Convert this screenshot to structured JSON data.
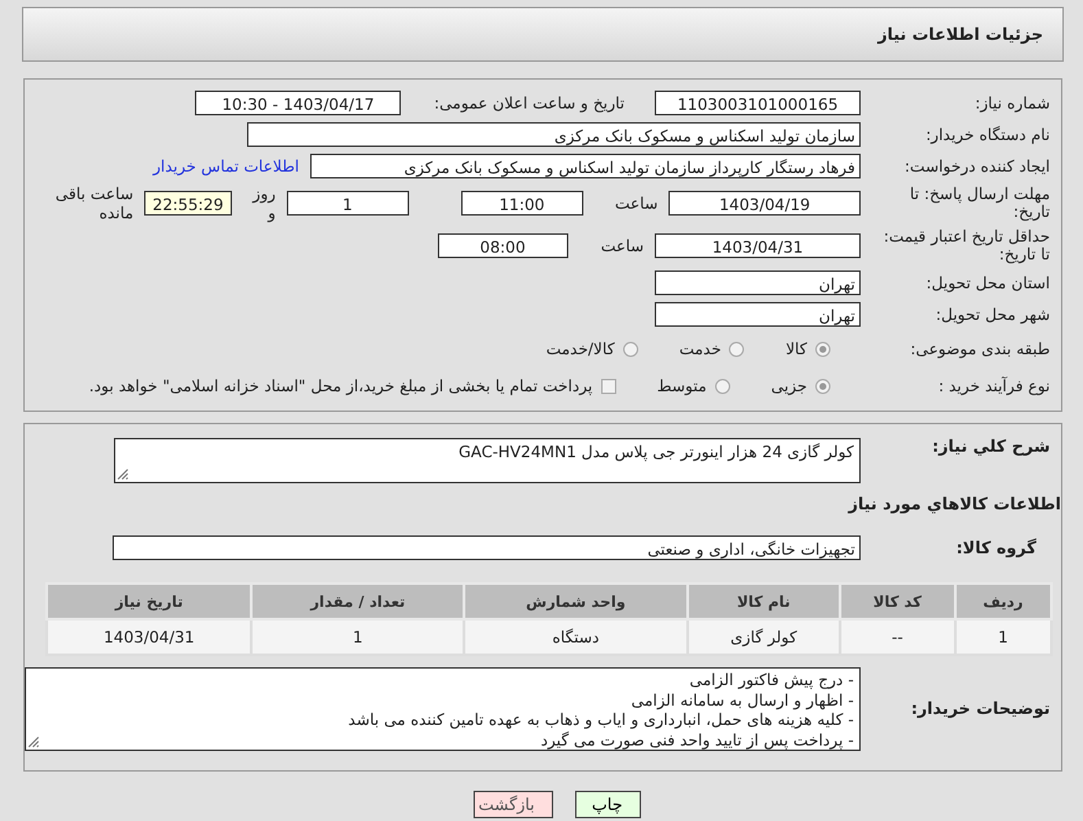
{
  "page_title": "جزئیات اطلاعات نیاز",
  "need_number": {
    "label": "شماره نیاز:",
    "value": "1103003101000165"
  },
  "announce": {
    "label": "تاریخ و ساعت اعلان عمومی:",
    "value": "1403/04/17 - 10:30"
  },
  "buyer_org": {
    "label": "نام دستگاه خریدار:",
    "value": "سازمان تولید اسکناس و مسکوک بانک مرکزی"
  },
  "requester": {
    "label": "ایجاد کننده درخواست:",
    "value": "فرهاد رستگار کارپرداز سازمان تولید اسکناس و مسکوک بانک مرکزی",
    "link": "اطلاعات تماس خریدار"
  },
  "reply_deadline": {
    "label": "مهلت ارسال پاسخ: تا تاریخ:",
    "date": "1403/04/19",
    "time_label": "ساعت",
    "time": "11:00",
    "days": "1",
    "days_label": "روز و",
    "remaining": "22:55:29",
    "remaining_label": "ساعت باقی مانده"
  },
  "price_validity": {
    "label": "حداقل تاریخ اعتبار قیمت: تا تاریخ:",
    "date": "1403/04/31",
    "time_label": "ساعت",
    "time": "08:00"
  },
  "province": {
    "label": "استان محل تحویل:",
    "value": "تهران"
  },
  "city": {
    "label": "شهر محل تحویل:",
    "value": "تهران"
  },
  "category": {
    "label": "طبقه بندی موضوعی:",
    "options": [
      {
        "label": "کالا",
        "selected": true
      },
      {
        "label": "خدمت",
        "selected": false
      },
      {
        "label": "کالا/خدمت",
        "selected": false
      }
    ]
  },
  "process": {
    "label": "نوع فرآیند خرید :",
    "options": [
      {
        "label": "جزیی",
        "selected": true
      },
      {
        "label": "متوسط",
        "selected": false
      }
    ],
    "treasury": {
      "label": "پرداخت تمام یا بخشی از مبلغ خرید،از محل \"اسناد خزانه اسلامی\" خواهد بود.",
      "checked": false
    }
  },
  "description": {
    "label": "شرح کلي نياز:",
    "value": "کولر گازی 24 هزار اینورتر جی پلاس مدل GAC-HV24MN1"
  },
  "goods_heading": "اطلاعات کالاهاي مورد نياز",
  "goods_group": {
    "label": "گروه کالا:",
    "value": "تجهیزات خانگی، اداری و صنعتی"
  },
  "table": {
    "columns": [
      "ردیف",
      "کد کالا",
      "نام کالا",
      "واحد شمارش",
      "تعداد / مقدار",
      "تاریخ نیاز"
    ],
    "rows": [
      [
        "1",
        "--",
        "کولر گازی",
        "دستگاه",
        "1",
        "1403/04/31"
      ]
    ]
  },
  "buyer_notes": {
    "label": "توضیحات خریدار:",
    "lines": [
      "- درج پیش فاکتور الزامی",
      "- اظهار و ارسال به سامانه الزامی",
      "- کلیه هزینه های حمل، انبارداری و ایاب و ذهاب به عهده تامین کننده می باشد",
      "- پرداخت پس از تایید واحد فنی صورت می گیرد"
    ]
  },
  "buttons": [
    {
      "label": "چاپ",
      "kind": "print"
    },
    {
      "label": "بازگشت",
      "kind": "back"
    }
  ]
}
